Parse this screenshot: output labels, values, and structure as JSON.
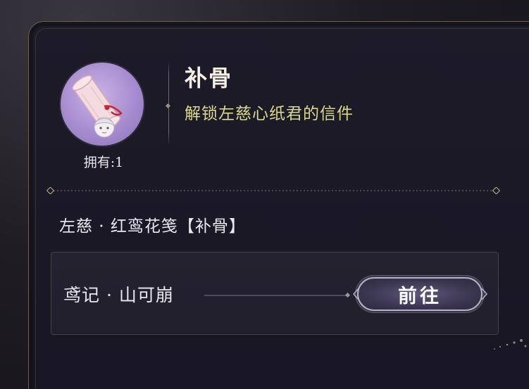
{
  "item": {
    "name": "补骨",
    "description": "解锁左慈心纸君的信件",
    "owned_label": "拥有:1",
    "icon": "scroll-icon"
  },
  "source": {
    "title": "左慈 · 红鸾花笺【补骨】"
  },
  "route": {
    "label": "鸢记 · 山可崩",
    "button_label": "前往"
  },
  "colors": {
    "panel_bg": "#1b1926",
    "title": "#f6f0e4",
    "description": "#d9d98a",
    "avatar_bg": "#a68ccf",
    "button_border": "#b7b0c6"
  }
}
